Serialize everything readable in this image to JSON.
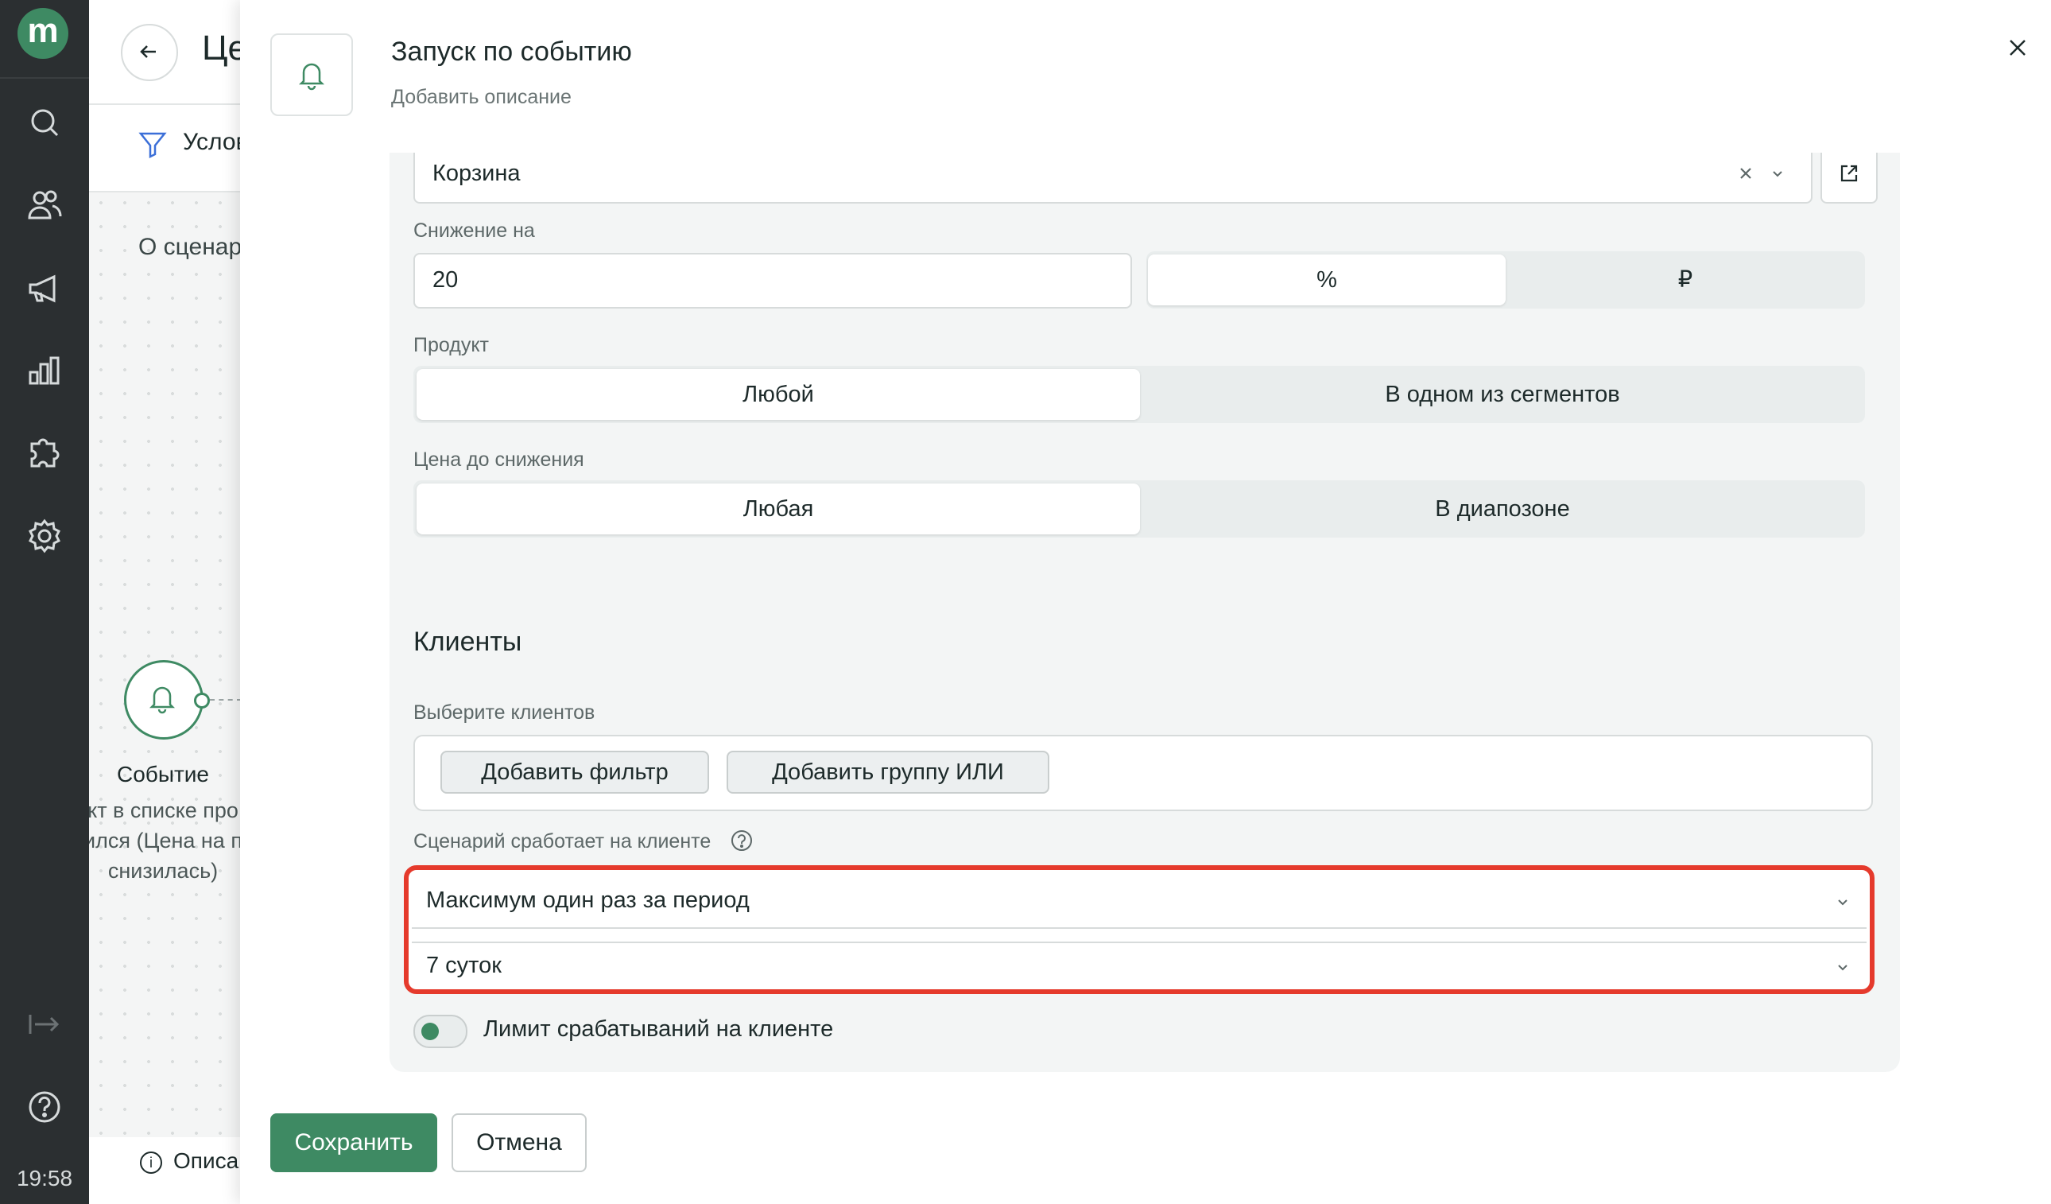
{
  "sidebar": {
    "logo": "m",
    "icons": [
      "search-icon",
      "users-icon",
      "megaphone-icon",
      "analytics-icon",
      "puzzle-icon",
      "settings-icon",
      "collapse-icon",
      "help-icon"
    ],
    "time": "19:58"
  },
  "background_page": {
    "title": "Це",
    "conditions_tab": "Услов",
    "about_label": "О сценар",
    "node_label": "Событие",
    "node_description": "кт в списке про\nился (Цена на п\nснизилась)",
    "footer_info": "Описа"
  },
  "modal": {
    "title": "Запуск по событию",
    "description": "Добавить описание",
    "cart_field": {
      "value": "Корзина"
    },
    "decrease": {
      "label": "Снижение на",
      "value": "20",
      "units": [
        "%",
        "₽"
      ],
      "selected_unit": "%"
    },
    "product": {
      "label": "Продукт",
      "options": [
        "Любой",
        "В одном из сегментов"
      ],
      "selected": "Любой"
    },
    "price_before": {
      "label": "Цена до снижения",
      "options": [
        "Любая",
        "В диапозоне"
      ],
      "selected": "Любая"
    },
    "clients": {
      "heading": "Клиенты",
      "select_label": "Выберите клиентов",
      "add_filter": "Добавить фильтр",
      "add_or_group": "Добавить группу ИЛИ",
      "trigger_label": "Сценарий сработает на клиенте",
      "trigger_mode": "Максимум один раз за период",
      "period": "7 суток",
      "limit_label": "Лимит срабатываний на клиенте",
      "limit_enabled": false
    },
    "save": "Сохранить",
    "cancel": "Отмена"
  },
  "colors": {
    "accent": "#3e8a63",
    "highlight": "#e53a2c",
    "sidebar": "#2b2f31"
  }
}
